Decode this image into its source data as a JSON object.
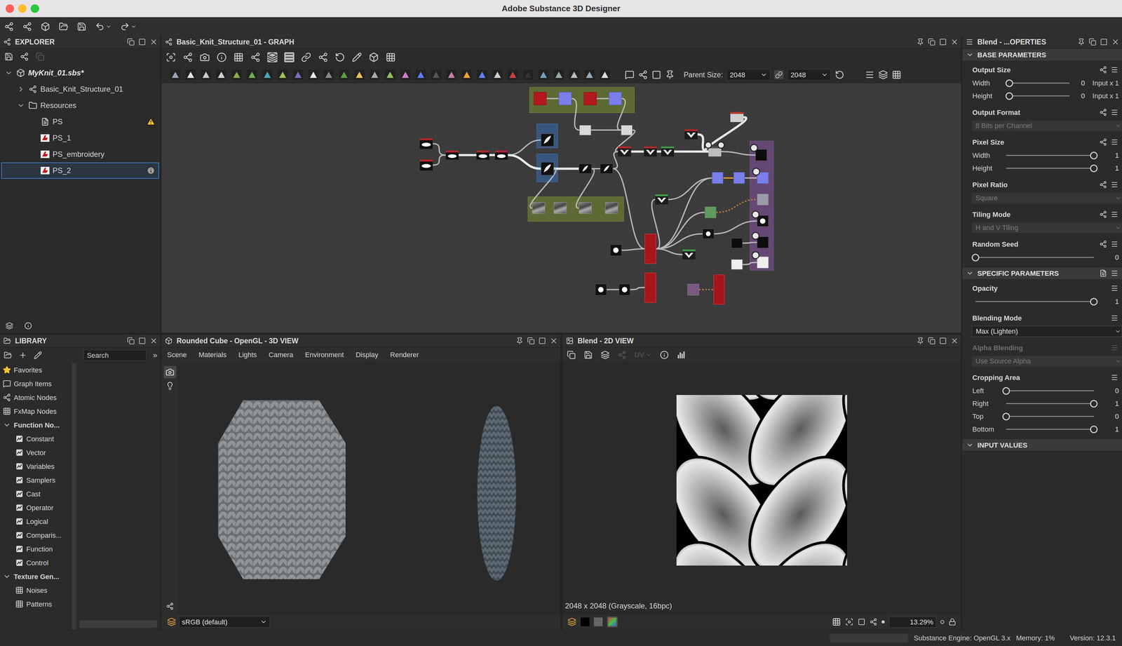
{
  "window": {
    "title": "Adobe Substance 3D Designer"
  },
  "explorer": {
    "title": "EXPLORER",
    "items": [
      {
        "label": "MyKnit_01.sbs*",
        "depth": 0,
        "kind": "package",
        "expandable": true,
        "expanded": true,
        "selected": false,
        "warning": false,
        "info": false
      },
      {
        "label": "Basic_Knit_Structure_01",
        "depth": 1,
        "kind": "graph",
        "expandable": true,
        "expanded": false,
        "selected": false,
        "warning": false,
        "info": false
      },
      {
        "label": "Resources",
        "depth": 1,
        "kind": "folder",
        "expandable": true,
        "expanded": true,
        "selected": false,
        "warning": false,
        "info": false
      },
      {
        "label": "PS",
        "depth": 2,
        "kind": "file",
        "expandable": false,
        "expanded": false,
        "selected": false,
        "warning": true,
        "info": false
      },
      {
        "label": "PS_1",
        "depth": 2,
        "kind": "bitmap",
        "expandable": false,
        "expanded": false,
        "selected": false,
        "warning": false,
        "info": false
      },
      {
        "label": "PS_embroidery",
        "depth": 2,
        "kind": "bitmap",
        "expandable": false,
        "expanded": false,
        "selected": false,
        "warning": false,
        "info": false
      },
      {
        "label": "PS_2",
        "depth": 2,
        "kind": "bitmap",
        "expandable": false,
        "expanded": false,
        "selected": true,
        "warning": false,
        "info": true
      }
    ]
  },
  "library": {
    "title": "LIBRARY",
    "search": {
      "placeholder": "Search",
      "overflow": "»"
    },
    "items": [
      {
        "label": "Favorites",
        "depth": 0,
        "kind": "favorite",
        "expanded": false
      },
      {
        "label": "Graph Items",
        "depth": 0,
        "kind": "graph-items",
        "expanded": false
      },
      {
        "label": "Atomic Nodes",
        "depth": 0,
        "kind": "atomic",
        "expanded": false
      },
      {
        "label": "FxMap Nodes",
        "depth": 0,
        "kind": "fxmap",
        "expanded": false
      },
      {
        "label": "Function No...",
        "depth": 0,
        "kind": "category",
        "expanded": true
      },
      {
        "label": "Constant",
        "depth": 1,
        "kind": "function",
        "expanded": false
      },
      {
        "label": "Vector",
        "depth": 1,
        "kind": "function",
        "expanded": false
      },
      {
        "label": "Variables",
        "depth": 1,
        "kind": "function",
        "expanded": false
      },
      {
        "label": "Samplers",
        "depth": 1,
        "kind": "function",
        "expanded": false
      },
      {
        "label": "Cast",
        "depth": 1,
        "kind": "function",
        "expanded": false
      },
      {
        "label": "Operator",
        "depth": 1,
        "kind": "function",
        "expanded": false
      },
      {
        "label": "Logical",
        "depth": 1,
        "kind": "function",
        "expanded": false
      },
      {
        "label": "Comparis...",
        "depth": 1,
        "kind": "function",
        "expanded": false
      },
      {
        "label": "Function",
        "depth": 1,
        "kind": "function",
        "expanded": false
      },
      {
        "label": "Control",
        "depth": 1,
        "kind": "function",
        "expanded": false
      },
      {
        "label": "Texture Gen...",
        "depth": 0,
        "kind": "category",
        "expanded": true
      },
      {
        "label": "Noises",
        "depth": 1,
        "kind": "texture",
        "expanded": false
      },
      {
        "label": "Patterns",
        "depth": 1,
        "kind": "texture",
        "expanded": false
      }
    ]
  },
  "graph": {
    "title": "Basic_Knit_Structure_01 - GRAPH",
    "parent_size_label": "Parent Size:",
    "parent_size": "2048",
    "parent_size_2": "2048"
  },
  "view3d": {
    "title": "Rounded Cube - OpenGL - 3D VIEW",
    "menu": [
      "Scene",
      "Materials",
      "Lights",
      "Camera",
      "Environment",
      "Display",
      "Renderer"
    ],
    "colorspace": "sRGB (default)"
  },
  "view2d": {
    "title": "Blend - 2D VIEW",
    "uv_label": "UV",
    "info": "2048 x 2048 (Grayscale, 16bpc)",
    "zoom": "13.29%"
  },
  "properties": {
    "title": "Blend - ...OPERTIES",
    "sections": [
      {
        "title": "BASE PARAMETERS",
        "expanded": true,
        "has_presets": false,
        "groups": [
          {
            "label": "Output Size",
            "inheritance": true,
            "disabled": false,
            "rows": [
              {
                "kind": "slider",
                "label": "Width",
                "value": "0",
                "suffix": "Input x 1",
                "level": 0.05
              },
              {
                "kind": "slider",
                "label": "Height",
                "value": "0",
                "suffix": "Input x 1",
                "level": 0.05
              }
            ]
          },
          {
            "label": "Output Format",
            "inheritance": true,
            "disabled": false,
            "rows": [
              {
                "kind": "dropdown",
                "value": "8 Bits per Channel",
                "disabled": true
              }
            ]
          },
          {
            "label": "Pixel Size",
            "inheritance": true,
            "disabled": false,
            "rows": [
              {
                "kind": "slider",
                "label": "Width",
                "value": "1",
                "level": 1
              },
              {
                "kind": "slider",
                "label": "Height",
                "value": "1",
                "level": 1
              }
            ]
          },
          {
            "label": "Pixel Ratio",
            "inheritance": true,
            "disabled": false,
            "rows": [
              {
                "kind": "dropdown",
                "value": "Square",
                "disabled": true
              }
            ]
          },
          {
            "label": "Tiling Mode",
            "inheritance": true,
            "disabled": false,
            "rows": [
              {
                "kind": "dropdown",
                "value": "H and V Tiling",
                "disabled": true
              }
            ]
          },
          {
            "label": "Random Seed",
            "inheritance": true,
            "disabled": false,
            "rows": [
              {
                "kind": "slider",
                "value": "0",
                "level": 0
              }
            ]
          }
        ]
      },
      {
        "title": "SPECIFIC PARAMETERS",
        "expanded": true,
        "has_presets": true,
        "groups": [
          {
            "label": "Opacity",
            "inheritance": false,
            "disabled": false,
            "rows": [
              {
                "kind": "slider",
                "value": "1",
                "level": 1
              }
            ]
          },
          {
            "label": "Blending Mode",
            "inheritance": false,
            "disabled": false,
            "rows": [
              {
                "kind": "dropdown",
                "value": "Max (Lighten)",
                "disabled": false
              }
            ]
          },
          {
            "label": "Alpha Blending",
            "inheritance": false,
            "disabled": true,
            "rows": [
              {
                "kind": "dropdown",
                "value": "Use Source Alpha",
                "disabled": true
              }
            ]
          },
          {
            "label": "Cropping Area",
            "inheritance": false,
            "disabled": false,
            "rows": [
              {
                "kind": "slider",
                "label": "Left",
                "value": "0",
                "level": 0
              },
              {
                "kind": "slider",
                "label": "Right",
                "value": "1",
                "level": 1
              },
              {
                "kind": "slider",
                "label": "Top",
                "value": "0",
                "level": 0
              },
              {
                "kind": "slider",
                "label": "Bottom",
                "value": "1",
                "level": 1
              }
            ]
          }
        ]
      },
      {
        "title": "INPUT VALUES",
        "expanded": true,
        "has_presets": false,
        "groups": []
      }
    ]
  },
  "status_bar": {
    "engine": "Substance Engine: OpenGL 3.x",
    "memory": "Memory: 1%",
    "version": "Version: 12.3.1"
  }
}
